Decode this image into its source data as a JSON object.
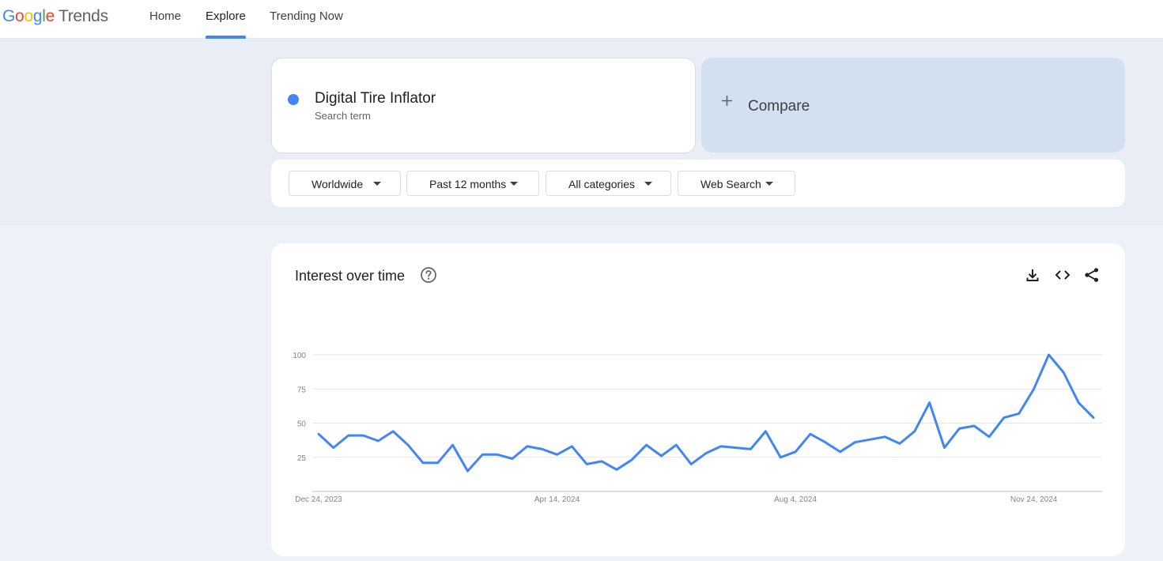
{
  "header": {
    "logo_google": [
      "G",
      "o",
      "o",
      "g",
      "l",
      "e"
    ],
    "logo_product": "Trends",
    "nav": {
      "home": "Home",
      "explore": "Explore",
      "trending": "Trending Now"
    }
  },
  "search": {
    "term": "Digital Tire Inflator",
    "term_type": "Search term",
    "term_color": "#4285f4",
    "compare_label": "Compare"
  },
  "filters": {
    "region": "Worldwide",
    "time_range": "Past 12 months",
    "category": "All categories",
    "search_type": "Web Search"
  },
  "interest": {
    "title": "Interest over time"
  },
  "icons": [
    "help-icon",
    "download-icon",
    "embed-icon",
    "share-icon",
    "plus-icon",
    "caret-down-icon"
  ],
  "chart_data": {
    "type": "line",
    "ylim": [
      0,
      100
    ],
    "y_ticks": [
      "25",
      "50",
      "75",
      "100"
    ],
    "x_tick_labels": [
      "Dec 24, 2023",
      "Apr 14, 2024",
      "Aug 4, 2024",
      "Nov 24, 2024"
    ],
    "x_tick_indices": [
      0,
      16,
      32,
      48
    ],
    "grid": true,
    "series": [
      {
        "color": "#4285f4",
        "values": [
          42,
          32,
          41,
          41,
          37,
          44,
          34,
          21,
          21,
          34,
          15,
          27,
          27,
          24,
          33,
          31,
          27,
          33,
          20,
          22,
          16,
          23,
          34,
          26,
          34,
          20,
          28,
          33,
          32,
          31,
          44,
          25,
          29,
          42,
          36,
          29,
          36,
          38,
          40,
          35,
          44,
          65,
          32,
          46,
          48,
          40,
          54,
          57,
          75,
          100,
          87,
          65,
          54
        ]
      }
    ]
  }
}
